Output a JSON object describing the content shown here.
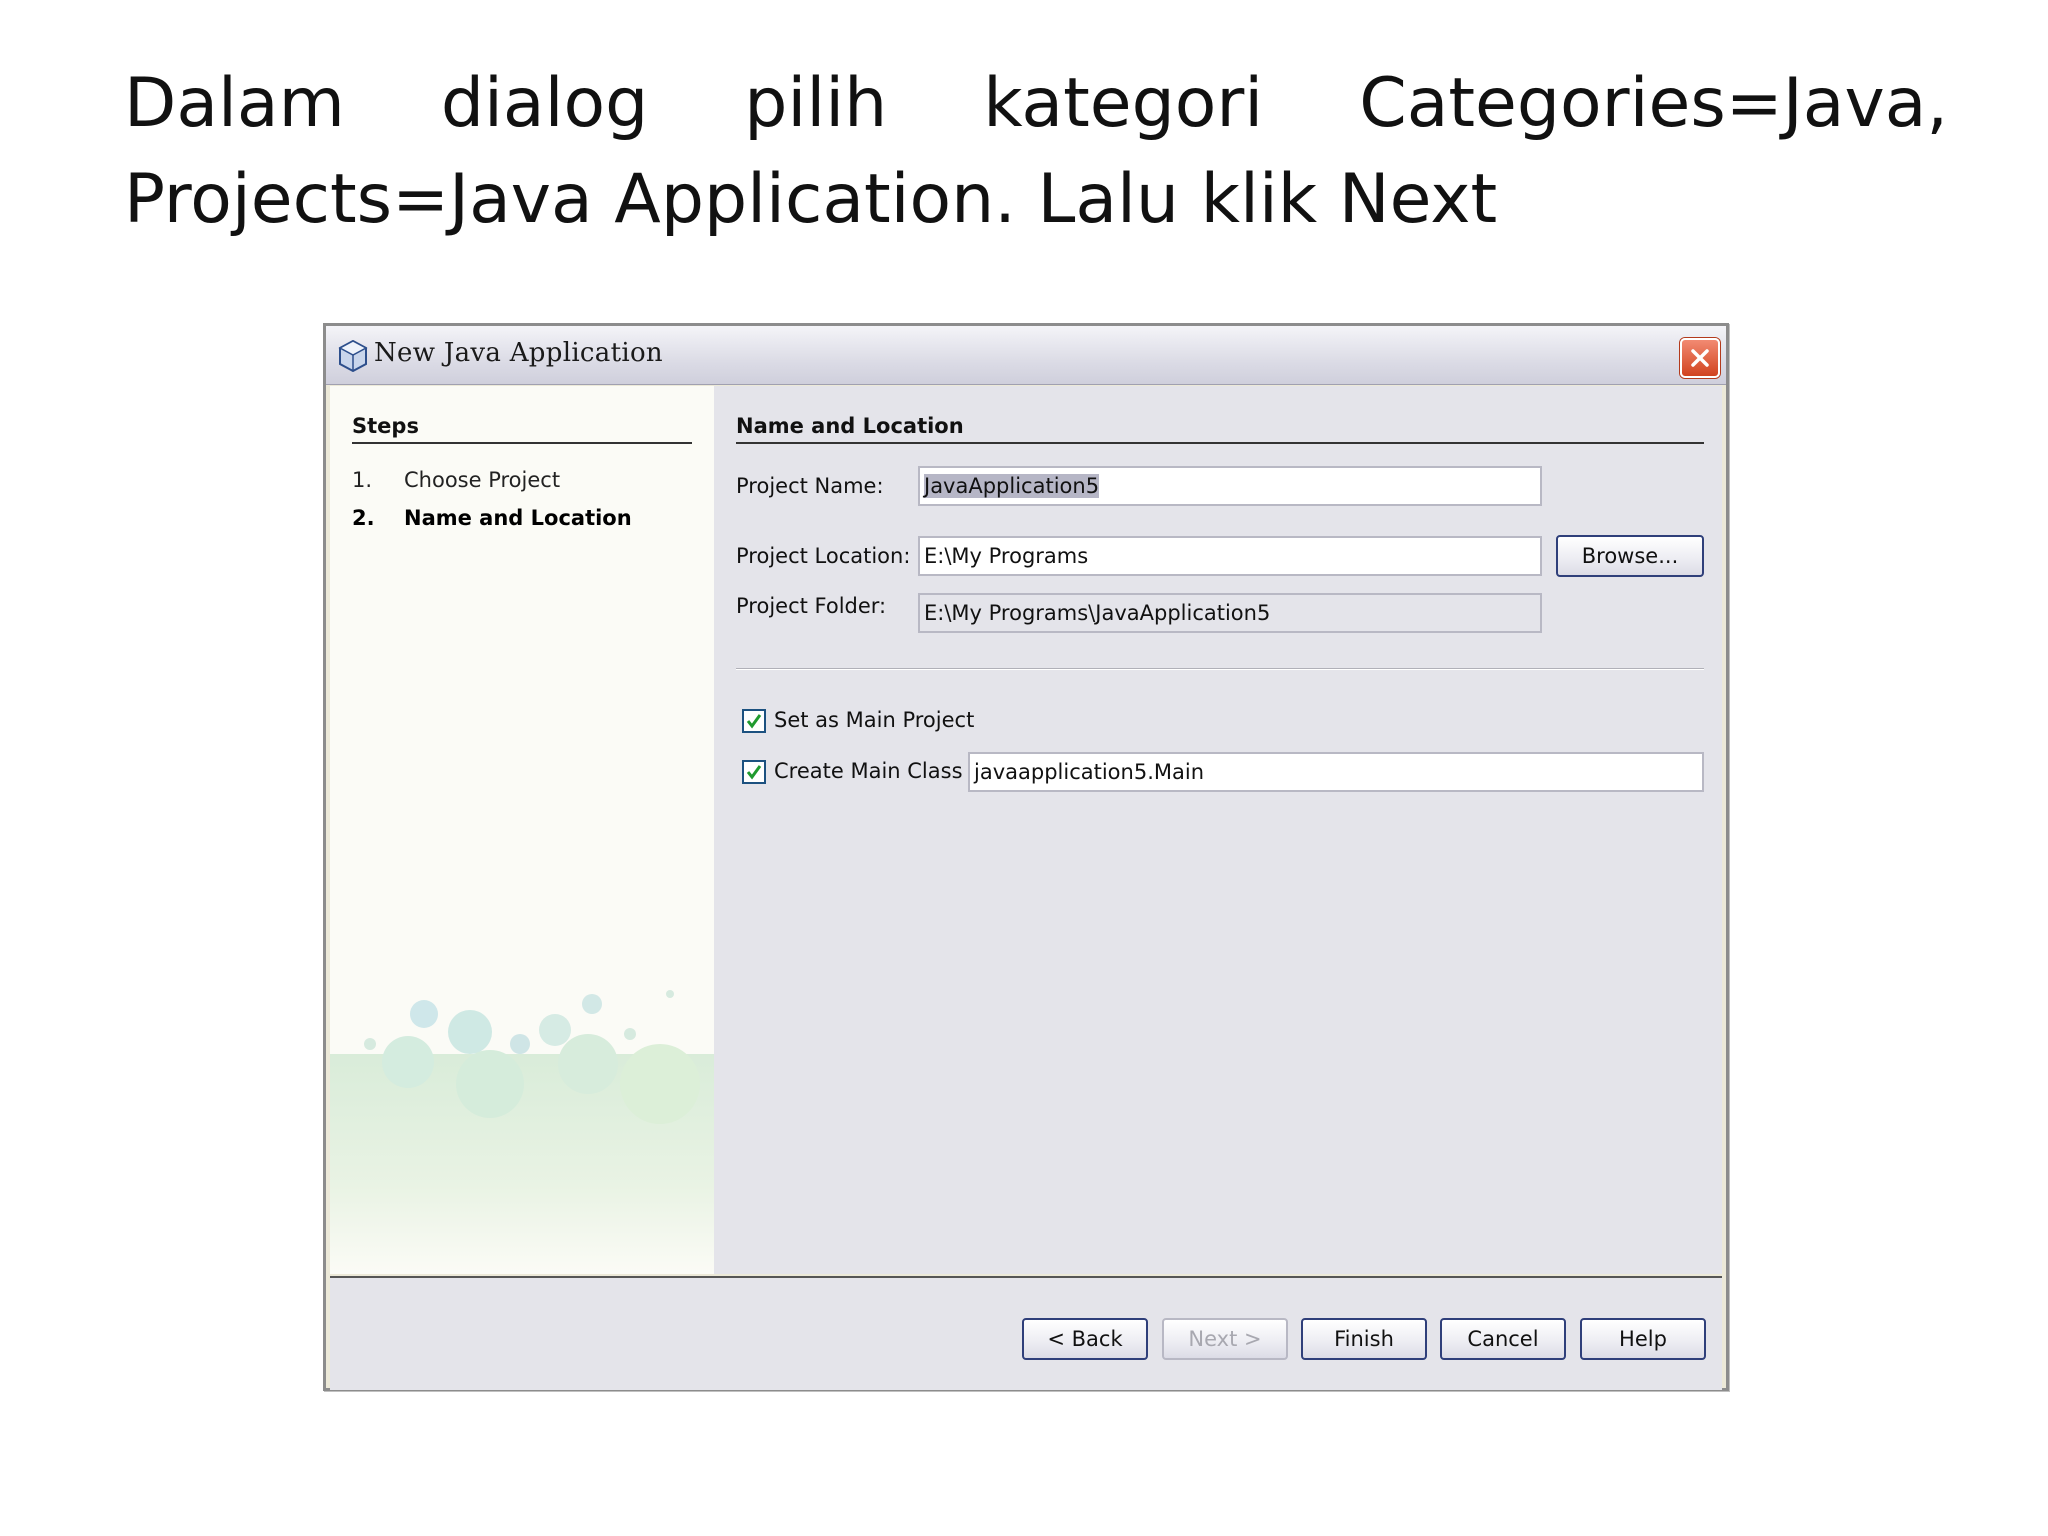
{
  "slide": {
    "line1_words": [
      "Dalam",
      "dialog",
      "pilih",
      "kategori",
      "Categories=Java,"
    ],
    "line2": "Projects=Java Application.  Lalu klik Next"
  },
  "dialog": {
    "title": "New Java Application",
    "steps": {
      "heading": "Steps",
      "items": [
        {
          "num": "1.",
          "label": "Choose Project"
        },
        {
          "num": "2.",
          "label": "Name and Location"
        }
      ]
    },
    "section_heading": "Name and Location",
    "project_name": {
      "label": "Project Name:",
      "value": "JavaApplication5"
    },
    "project_location": {
      "label": "Project Location:",
      "value": "E:\\My Programs"
    },
    "project_folder": {
      "label": "Project Folder:",
      "value": "E:\\My Programs\\JavaApplication5"
    },
    "browse_label": "Browse...",
    "set_main": {
      "label": "Set as Main Project",
      "checked": true
    },
    "create_main": {
      "label": "Create Main Class",
      "checked": true,
      "value": "javaapplication5.Main"
    },
    "buttons": {
      "back": "< Back",
      "next": "Next >",
      "finish": "Finish",
      "cancel": "Cancel",
      "help": "Help"
    }
  },
  "colors": {
    "accent": "#2f3f7a",
    "check": "#1f9a2e",
    "close": "#d1431f"
  }
}
